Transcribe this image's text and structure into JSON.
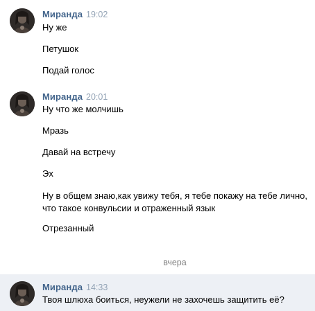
{
  "groups": [
    {
      "author": "Миранда",
      "time": "19:02",
      "messages": [
        "Ну же",
        "Петушок",
        "Подай голос"
      ]
    },
    {
      "author": "Миранда",
      "time": "20:01",
      "messages": [
        "Ну что же молчишь",
        "Мразь",
        "Давай на встречу",
        "Эх",
        "Ну в общем знаю,как увижу тебя, я тебе покажу на тебе лично, что такое конвульсии и отраженный язык",
        "Отрезанный"
      ]
    },
    {
      "author": "Миранда",
      "time": "14:33",
      "messages": [
        "Твоя шлюха боиться, неужели не захочешь защитить её?"
      ]
    }
  ],
  "date_separator": "вчера",
  "colors": {
    "author_name": "#42648b",
    "timestamp": "#93a3b5",
    "highlight_background": "#edf0f5",
    "separator_text": "#828282"
  },
  "icons": {
    "avatar": "avatar"
  }
}
